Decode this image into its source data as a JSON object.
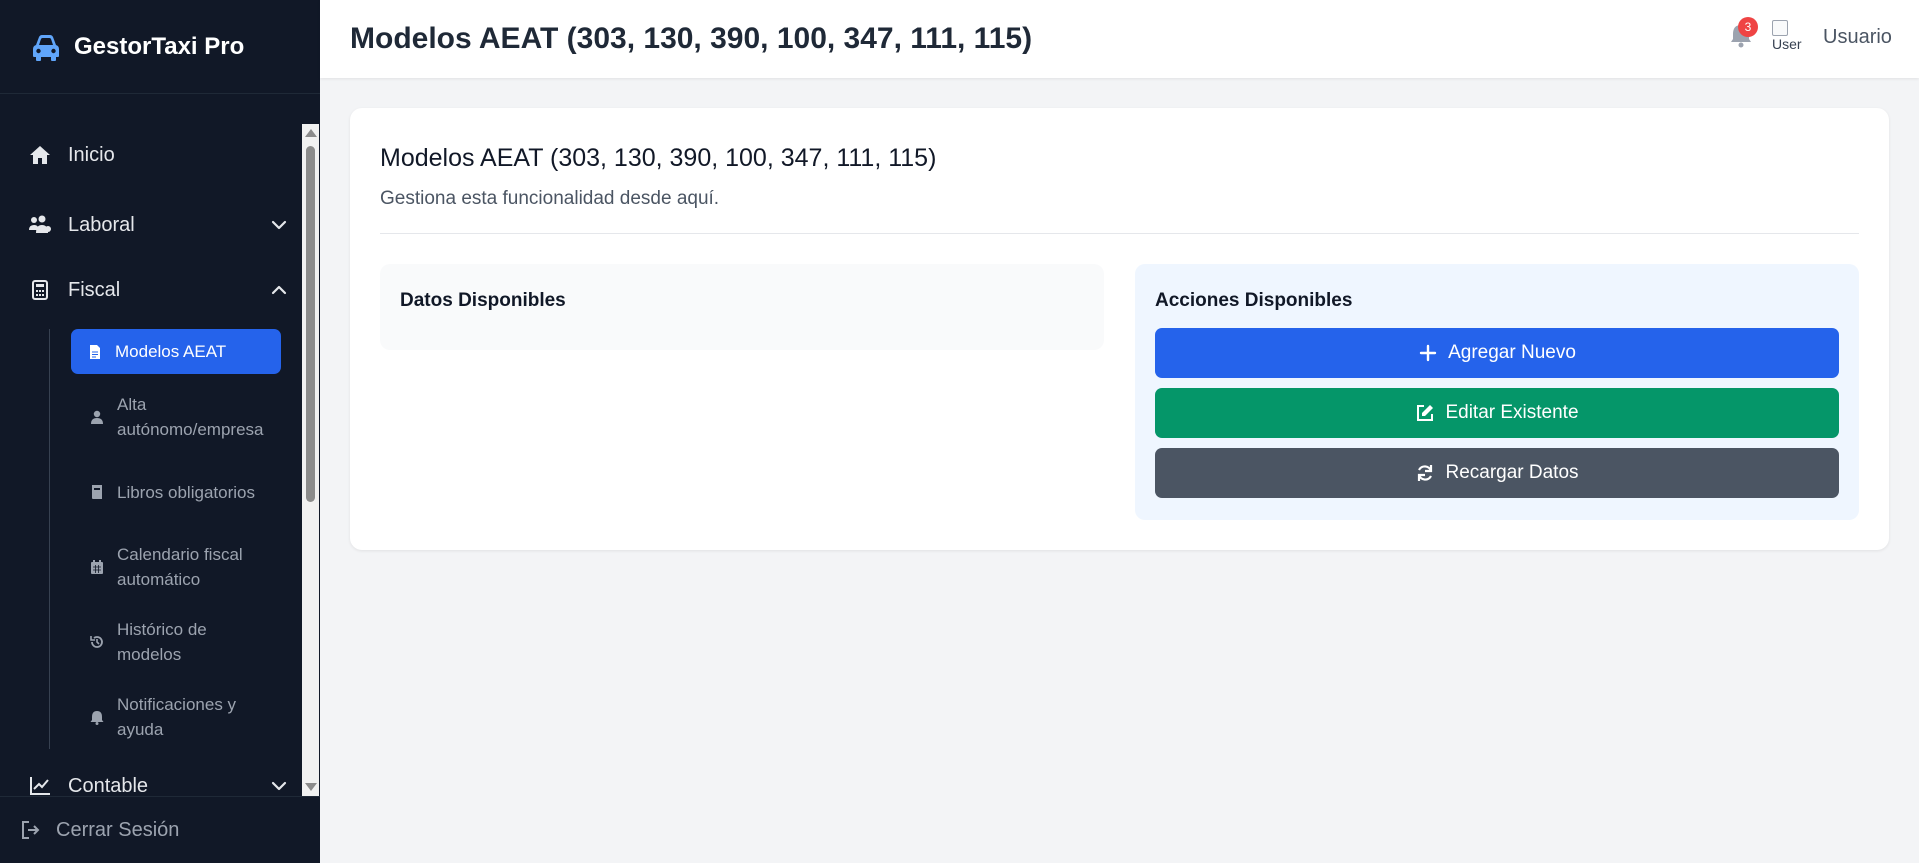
{
  "brand": {
    "name": "GestorTaxi Pro",
    "icon": "car-icon",
    "accent": "#60a5fa"
  },
  "sidebar": {
    "items": [
      {
        "label": "Inicio",
        "icon": "home-icon"
      },
      {
        "label": "Laboral",
        "icon": "users-icon",
        "expanded": false
      },
      {
        "label": "Fiscal",
        "icon": "calculator-icon",
        "expanded": true
      },
      {
        "label": "Contable",
        "icon": "chart-line-icon",
        "expanded": false
      }
    ],
    "fiscal_sub": [
      {
        "label": "Modelos AEAT",
        "icon": "file-icon",
        "active": true
      },
      {
        "label": "Alta autónomo/empresa",
        "icon": "user-icon"
      },
      {
        "label": "Libros obligatorios",
        "icon": "book-icon"
      },
      {
        "label": "Calendario fiscal automático",
        "icon": "calendar-icon"
      },
      {
        "label": "Histórico de modelos",
        "icon": "history-icon"
      },
      {
        "label": "Notificaciones y ayuda",
        "icon": "bell-icon"
      }
    ],
    "logout_label": "Cerrar Sesión"
  },
  "header": {
    "title": "Modelos AEAT (303, 130, 390, 100, 347, 111, 115)",
    "notification_count": "3",
    "avatar_alt": "User",
    "user_name": "Usuario"
  },
  "main": {
    "title": "Modelos AEAT (303, 130, 390, 100, 347, 111, 115)",
    "subtitle": "Gestiona esta funcionalidad desde aquí.",
    "data_panel_title": "Datos Disponibles",
    "actions_panel_title": "Acciones Disponibles",
    "actions": {
      "add": "Agregar Nuevo",
      "edit": "Editar Existente",
      "reload": "Recargar Datos"
    }
  },
  "colors": {
    "sidebar_bg": "#111827",
    "primary": "#2563eb",
    "success": "#059669",
    "secondary": "#4b5563",
    "badge": "#ef4444"
  }
}
